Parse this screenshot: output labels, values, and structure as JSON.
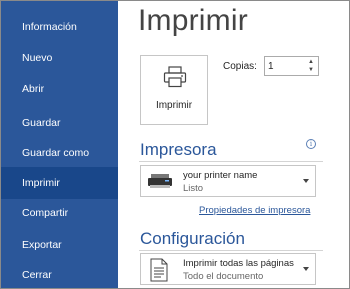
{
  "sidebar": {
    "items": [
      {
        "label": "Información"
      },
      {
        "label": "Nuevo"
      },
      {
        "label": "Abrir"
      },
      {
        "label": "Guardar"
      },
      {
        "label": "Guardar como"
      },
      {
        "label": "Imprimir",
        "selected": true
      },
      {
        "label": "Compartir"
      },
      {
        "label": "Exportar"
      },
      {
        "label": "Cerrar"
      }
    ]
  },
  "main": {
    "title": "Imprimir",
    "print_button": {
      "label": "Imprimir",
      "icon": "printer-icon"
    },
    "copies": {
      "label": "Copias:",
      "value": "1"
    },
    "printer_section": {
      "title": "Impresora",
      "info_icon": "info-icon",
      "printer_name": "your printer name",
      "printer_status": "Listo",
      "properties_link": "Propiedades de impresora"
    },
    "settings_section": {
      "title": "Configuración",
      "pages_option": "Imprimir todas las páginas",
      "pages_option_sub": "Todo el documento"
    }
  },
  "colors": {
    "sidebar_bg": "#2b579a",
    "sidebar_selected": "#19478a",
    "accent": "#2b579a"
  }
}
